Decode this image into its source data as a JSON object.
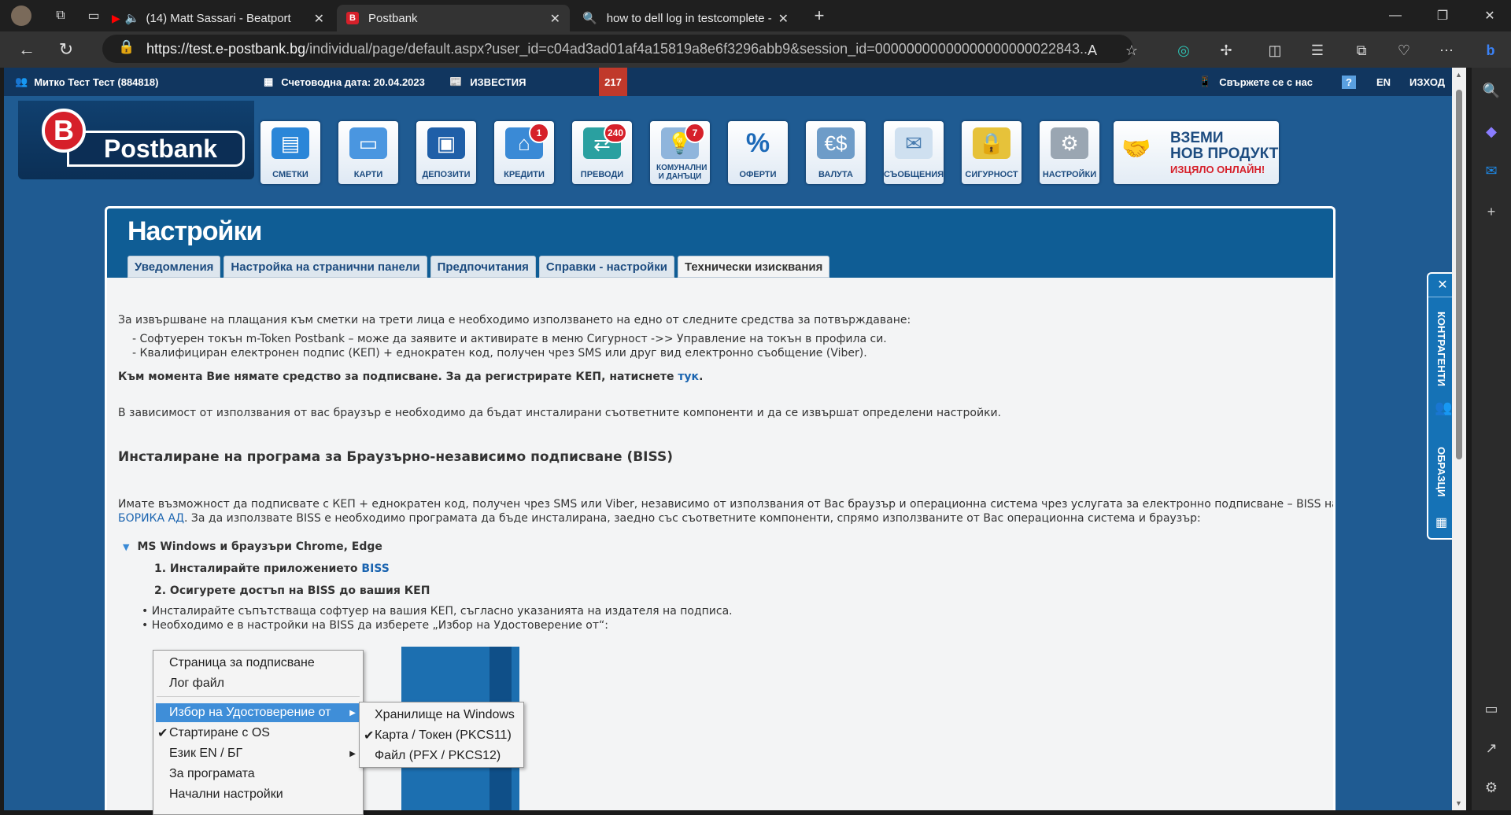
{
  "browser": {
    "tabs": [
      {
        "title": "(14) Matt Sassari - Beatport",
        "active": false
      },
      {
        "title": "Postbank",
        "active": true
      },
      {
        "title": "how to dell log in testcomplete -",
        "active": false
      }
    ],
    "url_host": "https://test.e-postbank.bg",
    "url_path": "/individual/page/default.aspx?user_id=c04ad3ad01af4a15819a8e6f3296abb9&session_id=00000000000000000000022843..."
  },
  "topline": {
    "user": "Митко Тест Тест (884818)",
    "accounting_date": "Счетоводна дата: 20.04.2023",
    "news": "ИЗВЕСТИЯ",
    "count": "217",
    "contact": "Свържете се с нас",
    "help": "?",
    "lang": "EN",
    "logout": "ИЗХОД"
  },
  "logo": {
    "letter": "B",
    "name": "Postbank"
  },
  "nav": [
    {
      "label": "СМЕТКИ",
      "icon": "wallet-icon",
      "badge": ""
    },
    {
      "label": "КАРТИ",
      "icon": "card-icon",
      "badge": ""
    },
    {
      "label": "ДЕПОЗИТИ",
      "icon": "safe-icon",
      "badge": ""
    },
    {
      "label": "КРЕДИТИ",
      "icon": "house-icon",
      "badge": "1"
    },
    {
      "label": "ПРЕВОДИ",
      "icon": "transfer-icon",
      "badge": "240"
    },
    {
      "label": "КОМУНАЛНИ И ДАНЪЦИ",
      "icon": "bulb-icon",
      "badge": "7"
    },
    {
      "label": "ОФЕРТИ",
      "icon": "percent-icon",
      "badge": ""
    },
    {
      "label": "ВАЛУТА",
      "icon": "currency-icon",
      "badge": ""
    },
    {
      "label": "СЪОБЩЕНИЯ",
      "icon": "envelope-icon",
      "badge": ""
    },
    {
      "label": "СИГУРНОСТ",
      "icon": "lock-icon",
      "badge": ""
    },
    {
      "label": "НАСТРОЙКИ",
      "icon": "gear-icon",
      "badge": ""
    }
  ],
  "promo": {
    "line1": "ВЗЕМИ",
    "line2": "НОВ ПРОДУКТ",
    "line3": "ИЗЦЯЛО ОНЛАЙН!"
  },
  "panel": {
    "title": "Настройки",
    "tabs": [
      "Уведомления",
      "Настройка на странични панели",
      "Предпочитания",
      "Справки - настройки",
      "Технически изисквания"
    ],
    "active_tab": 4
  },
  "content": {
    "p1": "За извършване на плащания към сметки на трети лица е необходимо използването на едно от следните средства за потвърждаване:",
    "li1": "- Софтуерен токън m-Token Postbank – може да заявите и активирате в меню Сигурност ->> Управление на токън в профила си.",
    "li2": "- Квалифициран електронен подпис (КЕП) + еднократен код, получен чрез SMS или друг вид електронно съобщение (Viber).",
    "p2_bold": "Към момента Вие нямате средство за подписване. За да регистрирате КЕП, натиснете ",
    "p2_link": "тук",
    "p3": "В зависимост от използвания от вас браузър е необходимо да бъдат инсталирани съответните компоненти и да се извършат определени настройки.",
    "h1": "Инсталиране на програма за Браузърно-независимо подписване (BISS)",
    "p4": "Имате възможност да подписвате с КЕП + еднократен код, получен чрез SMS или Viber, независимо от използвания от Вас браузър и операционна система чрез услугата за електронно подписване – BISS на",
    "p4_link": "БОРИКА АД",
    "p4b": ". За да използвате BISS е необходимо програмата да бъде инсталирана, заедно със съответните компоненти, спрямо използваните от Вас операционна система и браузър:",
    "section": "MS Windows и браузъри Chrome, Edge",
    "step1": "1. Инсталирайте приложението ",
    "step1_link": "BISS",
    "step2": "2. Осигурете достъп на BISS до вашия КЕП",
    "b1": "Инсталирайте съпътстваща софтуер на вашия КЕП, съгласно указанията на издателя на подписа.",
    "b2": "Необходимо е в настройки на BISS да изберете „Избор на Удостоверение от“:"
  },
  "ctxmenu": [
    "Страница за подписване",
    "Лог файл",
    "Избор на Удостоверение от",
    "Стартиране с OS",
    "Език EN / БГ",
    "За програмата",
    "Начални настройки"
  ],
  "submenu": [
    "Хранилище на Windows",
    "Карта / Токен (PKCS11)",
    "Файл (PFX / PKCS12)"
  ],
  "sidewidget": {
    "a": "КОНТРАГЕНТИ",
    "b": "ОБРАЗЦИ"
  }
}
